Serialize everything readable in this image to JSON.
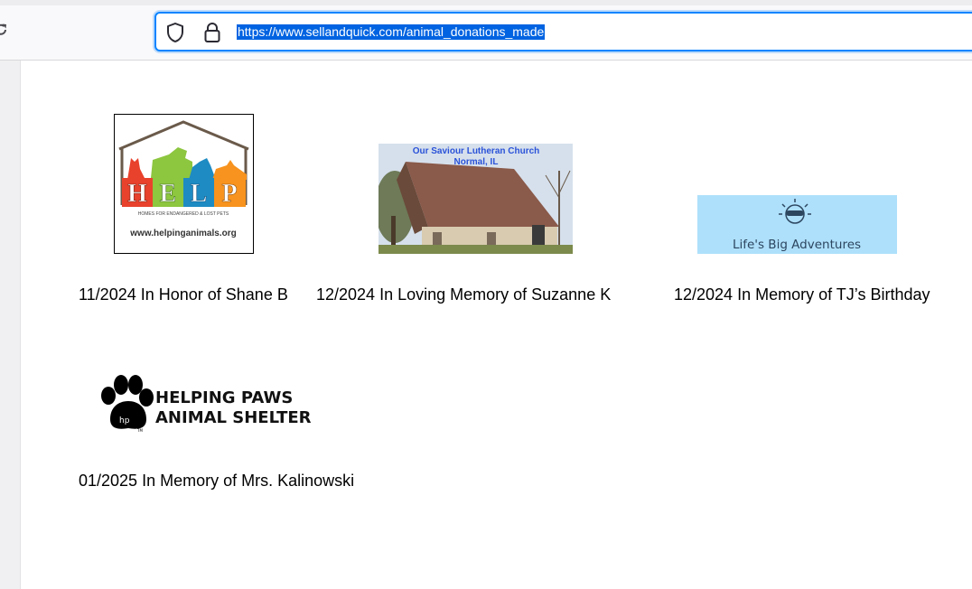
{
  "browser": {
    "url": "https://www.sellandquick.com/animal_donations_made"
  },
  "donations": [
    {
      "caption": "11/2024 In Honor of Shane B",
      "logo": {
        "name": "help-logo",
        "letters": [
          "H",
          "E",
          "L",
          "P"
        ],
        "tagline": "HOMES FOR ENDANGERED & LOST PETS",
        "website": "www.helpinganimals.org"
      }
    },
    {
      "caption": "12/2024 In Loving Memory of Suzanne K",
      "logo": {
        "name": "church-photo",
        "line1": "Our Saviour Lutheran Church",
        "line2": "Normal, IL"
      }
    },
    {
      "caption": "12/2024 In Memory of TJ’s Birthday",
      "logo": {
        "name": "lifes-big-adventures-logo",
        "text": "Life's Big Adventures"
      }
    },
    {
      "caption": "01/2025 In Memory of Mrs. Kalinowski",
      "logo": {
        "name": "helping-paws-logo",
        "line1": "HELPING PAWS",
        "line2": "ANIMAL SHELTER",
        "mark": "hp",
        "tm": "TM"
      }
    }
  ],
  "colors": {
    "accent": "#0a84ff",
    "selection": "#0063e1",
    "help_h": "#e8412c",
    "help_e": "#8dc63f",
    "help_l": "#1e8bc3",
    "help_p": "#f7931e",
    "adventure_bg": "#aee0fb",
    "church_text": "#2a52d8"
  }
}
